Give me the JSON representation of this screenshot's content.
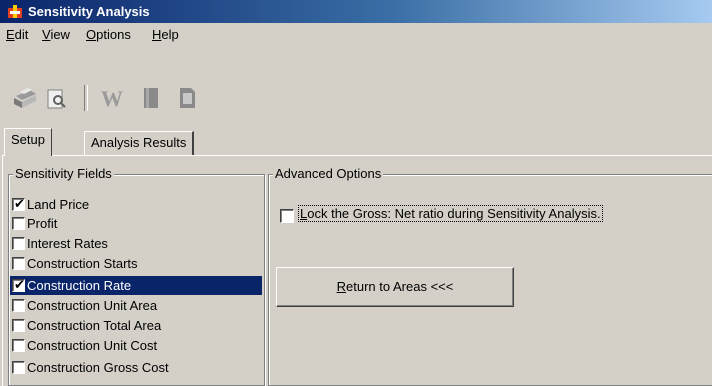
{
  "window": {
    "title": "Sensitivity Analysis"
  },
  "menu": {
    "items": [
      {
        "accel": "E",
        "rest": "dit"
      },
      {
        "accel": "V",
        "rest": "iew"
      },
      {
        "accel": "O",
        "rest": "ptions"
      },
      {
        "accel": "H",
        "rest": "elp"
      }
    ]
  },
  "tabs": [
    {
      "label": "Setup"
    },
    {
      "label": "Analysis Results"
    }
  ],
  "sensitivity_fields": {
    "title": "Sensitivity Fields",
    "items": [
      {
        "label": "Land Price",
        "checked": true,
        "selected": false
      },
      {
        "label": "Profit",
        "checked": false,
        "selected": false
      },
      {
        "label": "Interest Rates",
        "checked": false,
        "selected": false
      },
      {
        "label": "Construction Starts",
        "checked": false,
        "selected": false
      },
      {
        "label": "Construction Rate",
        "checked": true,
        "selected": true
      },
      {
        "label": "Construction Unit Area",
        "checked": false,
        "selected": false
      },
      {
        "label": "Construction Total Area",
        "checked": false,
        "selected": false
      },
      {
        "label": "Construction Unit Cost",
        "checked": false,
        "selected": false
      },
      {
        "label": "Construction Gross Cost",
        "checked": false,
        "selected": false
      }
    ]
  },
  "advanced_options": {
    "title": "Advanced Options",
    "lock_checkbox": {
      "accel": "L",
      "rest": "ock the Gross: Net ratio during Sensitivity Analysis.",
      "checked": false
    },
    "return_button": {
      "accel": "R",
      "rest": "eturn to Areas <<<"
    }
  },
  "icons": {
    "app": "app-icon",
    "toolbar": [
      "print-icon",
      "print-preview-icon",
      "word-icon",
      "book-icon",
      "document-icon"
    ]
  },
  "colors": {
    "titlebar_start": "#0a246a",
    "titlebar_end": "#a6caf0",
    "selection": "#0a246a",
    "face": "#d4d0c8"
  }
}
